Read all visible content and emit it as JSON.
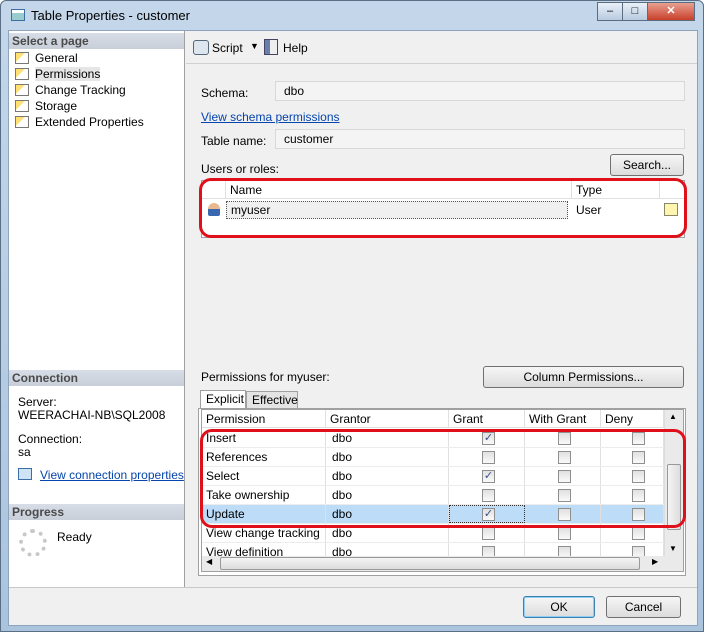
{
  "window": {
    "title": "Table Properties - customer",
    "buttons": [
      "minimize",
      "maximize",
      "close"
    ]
  },
  "left": {
    "select_header": "Select a page",
    "pages": [
      {
        "label": "General"
      },
      {
        "label": "Permissions",
        "selected": true
      },
      {
        "label": "Change Tracking"
      },
      {
        "label": "Storage"
      },
      {
        "label": "Extended Properties"
      }
    ],
    "connection_header": "Connection",
    "server_label": "Server:",
    "server_value": "WEERACHAI-NB\\SQL2008",
    "connection_label": "Connection:",
    "connection_value": "sa",
    "view_connection_link": "View connection properties",
    "progress_header": "Progress",
    "progress_status": "Ready"
  },
  "toolbar": {
    "script": "Script",
    "help": "Help"
  },
  "main": {
    "schema_label": "Schema:",
    "schema_value": "dbo",
    "view_schema_link": "View schema permissions",
    "table_name_label": "Table name:",
    "table_name_value": "customer",
    "users_label": "Users or roles:",
    "search_button": "Search...",
    "users_columns": [
      "Name",
      "Type"
    ],
    "users_rows": [
      {
        "name": "myuser",
        "type": "User"
      }
    ],
    "permissions_label": "Permissions for myuser:",
    "column_permissions_button": "Column Permissions...",
    "tabs": [
      {
        "label": "Explicit",
        "active": true
      },
      {
        "label": "Effective"
      }
    ],
    "perm_columns": [
      "Permission",
      "Grantor",
      "Grant",
      "With Grant",
      "Deny"
    ],
    "perm_rows": [
      {
        "permission": "Insert",
        "grantor": "dbo",
        "grant": true,
        "with_grant": false,
        "deny": false
      },
      {
        "permission": "References",
        "grantor": "dbo",
        "grant": false,
        "with_grant": false,
        "deny": false
      },
      {
        "permission": "Select",
        "grantor": "dbo",
        "grant": true,
        "with_grant": false,
        "deny": false
      },
      {
        "permission": "Take ownership",
        "grantor": "dbo",
        "grant": false,
        "with_grant": false,
        "deny": false
      },
      {
        "permission": "Update",
        "grantor": "dbo",
        "grant": true,
        "with_grant": false,
        "deny": false,
        "selected": true
      },
      {
        "permission": "View change tracking",
        "grantor": "dbo",
        "grant": false,
        "with_grant": false,
        "deny": false
      },
      {
        "permission": "View definition",
        "grantor": "dbo",
        "grant": false,
        "with_grant": false,
        "deny": false
      }
    ]
  },
  "footer": {
    "ok": "OK",
    "cancel": "Cancel"
  },
  "colors": {
    "highlight": "#e0101a",
    "selected_row": "#bcdcf8",
    "link": "#0645ad"
  }
}
